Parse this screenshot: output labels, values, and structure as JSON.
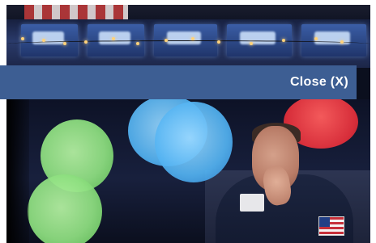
{
  "overlay": {
    "close_label": "Close (X)",
    "bar_color": "#3d5e93",
    "text_color": "#ffffff"
  },
  "photo": {
    "subject": "trader-with-hand-on-face",
    "accent_colors": {
      "bokeh_green": "#8fe081",
      "bokeh_blue": "#53b3f2",
      "bokeh_red": "#e12e3a"
    }
  }
}
